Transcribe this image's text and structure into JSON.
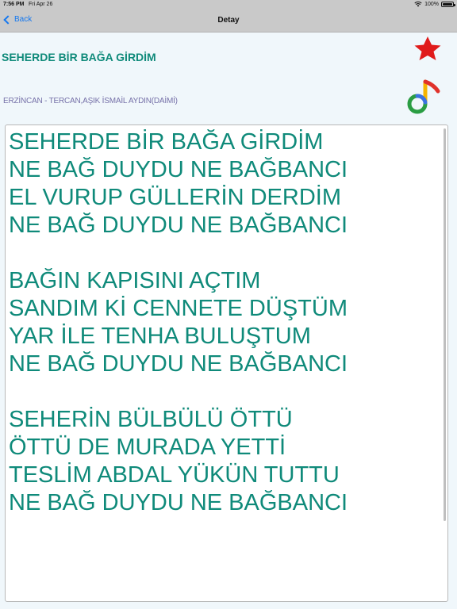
{
  "status_bar": {
    "time": "7:56 PM",
    "date": "Fri Apr 26",
    "battery": "100%"
  },
  "nav": {
    "back_label": "Back",
    "title": "Detay"
  },
  "song": {
    "title": "SEHERDE BİR BAĞA GİRDİM",
    "info": "ERZİNCAN - TERCAN,AŞIK İSMAİL AYDIN(DAİMİ)",
    "lyrics": "SEHERDE BİR BAĞA GİRDİM\nNE BAĞ DUYDU NE BAĞBANCI\nEL VURUP GÜLLERİN DERDİM\nNE BAĞ DUYDU NE BAĞBANCI\n\nBAĞIN KAPISINI AÇTIM\nSANDIM Kİ CENNETE DÜŞTÜM\nYAR İLE TENHA BULUŞTUM\nNE BAĞ DUYDU NE BAĞBANCI\n\nSEHERİN BÜLBÜLÜ ÖTTÜ\nÖTTÜ DE MURADA YETTİ\nTESLİM ABDAL YÜKÜN TUTTU\nNE BAĞ DUYDU NE BAĞBANCI"
  },
  "icons": {
    "favorite": "star-icon",
    "music": "music-note-icon",
    "back": "chevron-left-icon",
    "wifi": "wifi-icon",
    "battery": "battery-icon"
  },
  "colors": {
    "accent": "#0f8a7a",
    "info": "#7570a8",
    "link": "#1478f0",
    "star": "#e01b1b"
  }
}
